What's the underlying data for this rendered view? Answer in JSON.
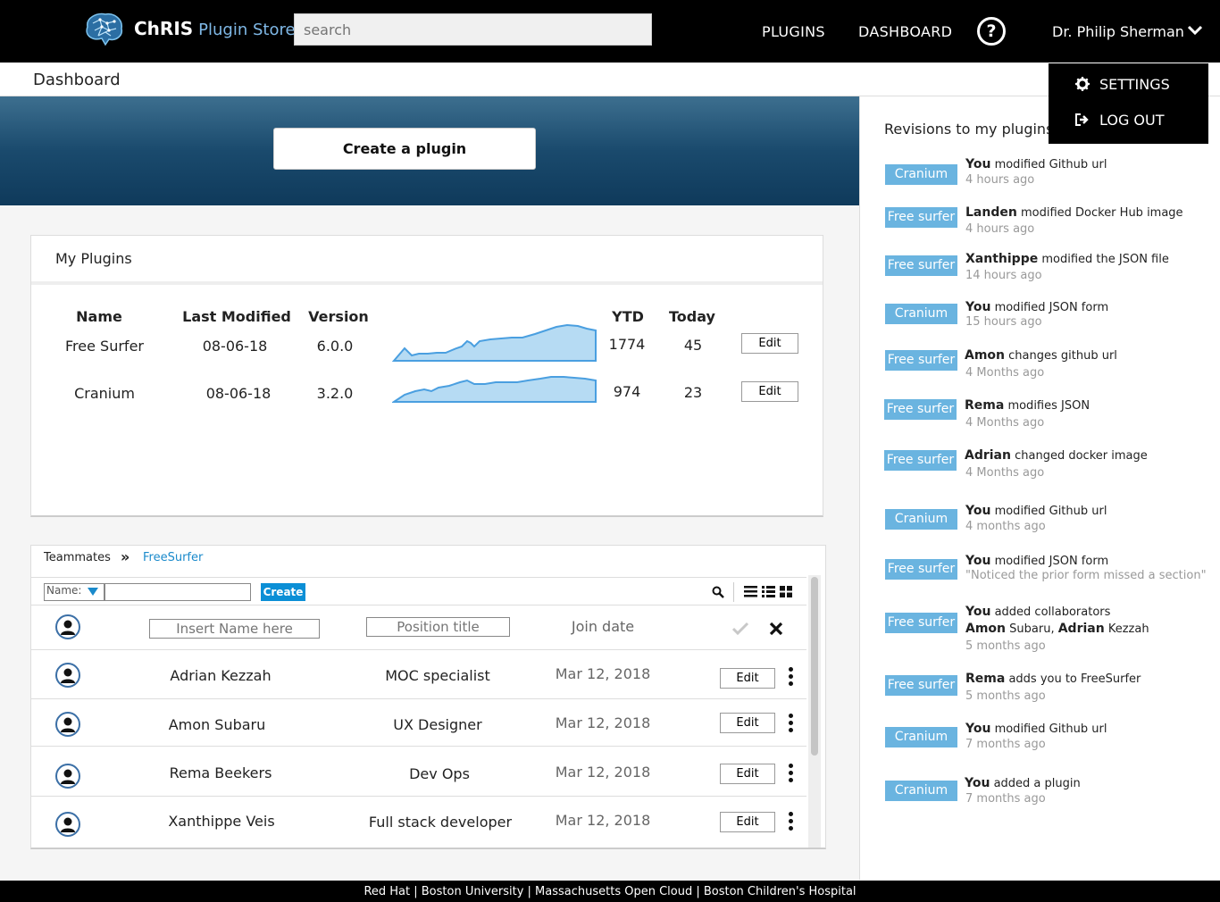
{
  "header": {
    "brand_bold": "ChRIS",
    "brand_rest": "Plugin Store",
    "search_placeholder": "search",
    "nav_plugins": "PLUGINS",
    "nav_dashboard": "DASHBOARD",
    "help_symbol": "?",
    "user_name": "Dr. Philip Sherman"
  },
  "user_menu": {
    "settings": "SETTINGS",
    "logout": "LOG OUT"
  },
  "page": {
    "title": "Dashboard",
    "create_plugin": "Create a plugin"
  },
  "my_plugins": {
    "title": "My Plugins",
    "columns": {
      "name": "Name",
      "last_modified": "Last Modified",
      "version": "Version",
      "ytd": "YTD",
      "today": "Today"
    },
    "edit_label": "Edit",
    "rows": [
      {
        "name": "Free Surfer",
        "last_modified": "08-06-18",
        "version": "6.0.0",
        "ytd": "1774",
        "today": "45"
      },
      {
        "name": "Cranium",
        "last_modified": "08-06-18",
        "version": "3.2.0",
        "ytd": "974",
        "today": "23"
      }
    ]
  },
  "teammates": {
    "crumb_root": "Teammates",
    "crumb_sep": "»",
    "crumb_current": "FreeSurfer",
    "filter_label": "Name:",
    "create_label": "Create",
    "new_row": {
      "name_placeholder": "Insert Name here",
      "position_placeholder": "Position title",
      "join_date_label": "Join date"
    },
    "edit_label": "Edit",
    "members": [
      {
        "name": "Adrian Kezzah",
        "position": "MOC specialist",
        "joined": "Mar 12, 2018"
      },
      {
        "name": "Amon Subaru",
        "position": "UX Designer",
        "joined": "Mar 12, 2018"
      },
      {
        "name": "Rema Beekers",
        "position": "Dev Ops",
        "joined": "Mar 12, 2018"
      },
      {
        "name": "Xanthippe Veis",
        "position": "Full stack developer",
        "joined": "Mar 12, 2018"
      }
    ]
  },
  "revisions": {
    "title": "Revisions to my plugins",
    "items": [
      {
        "tag": "Cranium",
        "actor": "You",
        "action": " modified Github url",
        "time": "4 hours ago"
      },
      {
        "tag": "Free surfer",
        "actor": "Landen",
        "action": " modified Docker Hub image",
        "time": "4 hours ago"
      },
      {
        "tag": "Free surfer",
        "actor": "Xanthippe",
        "action": " modified the JSON file",
        "time": "14 hours ago"
      },
      {
        "tag": "Cranium",
        "actor": "You",
        "action": " modified JSON form",
        "time": "15 hours ago"
      },
      {
        "tag": "Free surfer",
        "actor": "Amon",
        "action": " changes github url",
        "time": "4 Months ago"
      },
      {
        "tag": "Free surfer",
        "actor": "Rema",
        "action": " modifies JSON",
        "time": "4 Months ago"
      },
      {
        "tag": "Free surfer",
        "actor": "Adrian",
        "action": " changed docker image",
        "time": "4 Months ago"
      },
      {
        "tag": "Cranium",
        "actor": "You",
        "action": " modified Github url",
        "time": "4 months ago"
      },
      {
        "tag": "Free surfer",
        "actor": "You",
        "action": " modified JSON form",
        "time": "\"Noticed the prior form missed a section\""
      },
      {
        "tag": "Free surfer",
        "actor": "You",
        "action": " added collaborators",
        "collab_1": "Amon",
        "collab_1_rest": " Subaru, ",
        "collab_2": "Adrian",
        "collab_2_rest": " Kezzah",
        "time": "5 months ago"
      },
      {
        "tag": "Free surfer",
        "actor": "Rema",
        "action": " adds you to FreeSurfer",
        "time": "5 months ago"
      },
      {
        "tag": "Cranium",
        "actor": "You",
        "action": " modified Github url",
        "time": "7 months ago"
      },
      {
        "tag": "Cranium",
        "actor": "You",
        "action": " added a plugin",
        "time": "7 months ago"
      }
    ]
  },
  "footer": {
    "text": "Red Hat  | Boston University | Massachusetts Open Cloud | Boston Children's Hospital"
  }
}
